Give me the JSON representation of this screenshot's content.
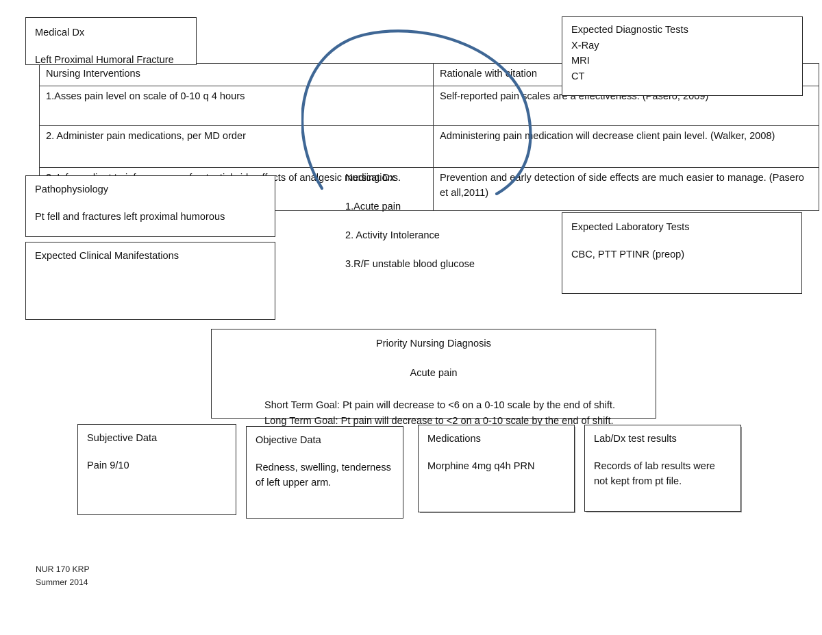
{
  "document": {
    "type": "nursing-concept-map",
    "accent_color": "#3f6795",
    "border_color": "#2a2a2a",
    "background": "#ffffff"
  },
  "medical_dx": {
    "title": "Medical Dx",
    "value": "Left Proximal Humoral Fracture"
  },
  "expected_diagnostic_tests": {
    "title": "Expected Diagnostic Tests",
    "items": [
      "X-Ray",
      "MRI",
      "CT"
    ]
  },
  "intervention_table": {
    "headers": [
      "Nursing Interventions",
      "Rationale with citation"
    ],
    "rows": [
      {
        "intervention": "1.Asses pain level on scale of 0-10 q 4 hours",
        "rationale": "Self-reported pain scales are a effectiveness. (Pasero, 2009)"
      },
      {
        "intervention": "2. Administer pain medications, per MD order",
        "rationale": "Administering pain medication will decrease client pain level. (Walker, 2008)"
      },
      {
        "intervention": "3. Inform client to inform nurse of potential side effects of analgesic medications.",
        "rationale": "Prevention and early detection of side effects are much easier to manage. (Pasero et all,2011)"
      }
    ]
  },
  "pathophysiology": {
    "title": "Pathophysiology",
    "value": "Pt fell and fractures left proximal humorous"
  },
  "expected_clinical_manifestations": {
    "title": "Expected Clinical Manifestations",
    "value": ""
  },
  "nursing_dx": {
    "title": "Nursing Dx",
    "items": [
      "1.Acute pain",
      "2. Activity Intolerance",
      "3.R/F unstable blood glucose"
    ]
  },
  "expected_laboratory_tests": {
    "title": "Expected Laboratory Tests",
    "value": "CBC, PTT PTINR (preop)"
  },
  "priority_nursing_diagnosis": {
    "title": "Priority Nursing Diagnosis",
    "diagnosis": "Acute pain",
    "short_term_goal": "Short Term Goal: Pt pain will decrease to <6 on a 0-10 scale by the end of shift.",
    "long_term_goal": "Long Term Goal: Pt pain will decrease to <2 on a 0-10 scale by the end of shift."
  },
  "data_boxes": {
    "subjective": {
      "title": "Subjective Data",
      "value": "Pain 9/10"
    },
    "objective": {
      "title": "Objective Data",
      "line1": "Redness, swelling, tenderness",
      "line2": "of left upper arm."
    },
    "medications": {
      "title": "Medications",
      "value": "Morphine 4mg q4h PRN"
    },
    "lab_dx_results": {
      "title": "Lab/Dx test results",
      "line1": "Records of lab results were",
      "line2": "not kept from pt file."
    }
  },
  "footer": {
    "course": "NUR 170 KRP",
    "term": "Summer 2014"
  }
}
